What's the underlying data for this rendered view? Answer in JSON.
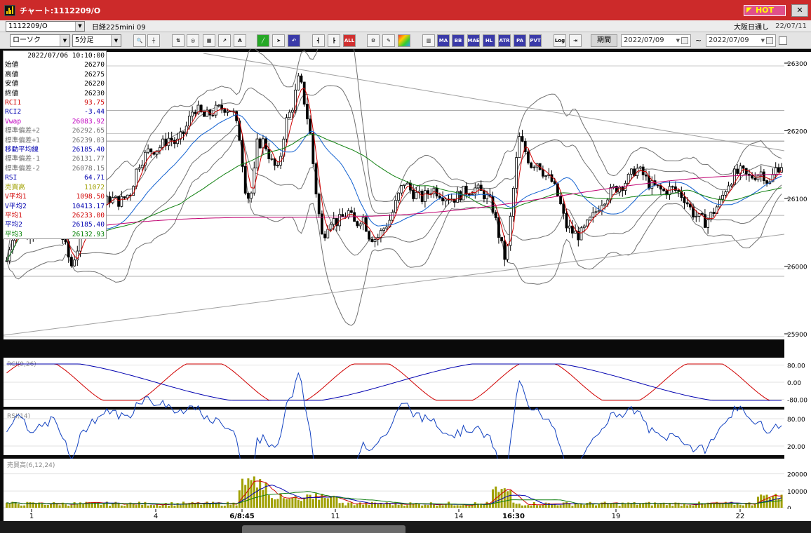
{
  "window": {
    "title": "チャート:1112209/O",
    "hot_label": "HOT",
    "close_glyph": "✕"
  },
  "inforow": {
    "symbol": "1112209/O",
    "instrument_name": "日経225mini 09",
    "market": "大阪日通し",
    "date": "22/07/11"
  },
  "toolbar": {
    "chart_type": "ローソク",
    "interval": "5分足",
    "buttons": [
      "search",
      "crosshair",
      "trend",
      "zoom",
      "grid",
      "line",
      "text",
      "draw",
      "pointer",
      "undo",
      "bar1",
      "bar2",
      "ALL",
      "settings",
      "tools",
      "palette",
      "multi",
      "MA",
      "BB",
      "MAE",
      "HL",
      "ATR",
      "PA",
      "PVT",
      "Log",
      "export"
    ],
    "period_label": "期間",
    "date_from": "2022/07/09",
    "date_to": "2022/07/09",
    "range_sep": "~"
  },
  "infopanel": {
    "timestamp": "2022/07/06  10:10:00",
    "rows": [
      {
        "label": "始値",
        "value": "26270",
        "color": "#000000"
      },
      {
        "label": "高値",
        "value": "26275",
        "color": "#000000"
      },
      {
        "label": "安値",
        "value": "26220",
        "color": "#000000"
      },
      {
        "label": "終値",
        "value": "26230",
        "color": "#000000"
      },
      {
        "label": "RCI1",
        "value": "93.75",
        "color": "#d00000"
      },
      {
        "label": "RCI2",
        "value": "-3.44",
        "color": "#0000b0"
      },
      {
        "label": "Vwap",
        "value": "26083.92",
        "color": "#c000c0"
      },
      {
        "label": "標準偏差+2",
        "value": "26292.65",
        "color": "#707070"
      },
      {
        "label": "標準偏差+1",
        "value": "26239.03",
        "color": "#707070"
      },
      {
        "label": "移動平均線",
        "value": "26185.40",
        "color": "#0000b0"
      },
      {
        "label": "標準偏差-1",
        "value": "26131.77",
        "color": "#707070"
      },
      {
        "label": "標準偏差-2",
        "value": "26078.15",
        "color": "#707070"
      },
      {
        "label": "RSI",
        "value": "64.71",
        "color": "#0000b0"
      },
      {
        "label": "売買高",
        "value": "11072",
        "color": "#a0a000"
      },
      {
        "label": "V平均1",
        "value": "1098.50",
        "color": "#d00000"
      },
      {
        "label": "V平均2",
        "value": "10413.17",
        "color": "#0000b0"
      },
      {
        "label": "平均1",
        "value": "26233.00",
        "color": "#d00000"
      },
      {
        "label": "平均2",
        "value": "26185.40",
        "color": "#0000b0"
      },
      {
        "label": "平均3",
        "value": "26132.93",
        "color": "#008000"
      }
    ]
  },
  "colors": {
    "bg": "#ffffff",
    "candle": "#000000",
    "ma_fast": "#d00000",
    "ma_mid": "#1060d0",
    "ma_slow": "#108010",
    "vwap": "#c00070",
    "bands": "#707070",
    "rsi": "#1040c0",
    "volume": "#a0a000"
  },
  "chart_data": {
    "type": "candlestick",
    "price_axis": {
      "ticks": [
        "26300",
        "26200",
        "26100",
        "26000",
        "25900"
      ]
    },
    "rci_panel": {
      "label": "RCI(9,26)",
      "ticks": [
        "80.00",
        "0.00",
        "-80.00"
      ]
    },
    "rsi_panel": {
      "label": "RSI(14)",
      "ticks": [
        "80.00",
        "20.00"
      ]
    },
    "volume_panel": {
      "label": "売買高(6,12,24)",
      "ticks": [
        "20000",
        "10000",
        "0"
      ]
    },
    "x_labels": [
      "1",
      "4",
      "6/8:45",
      "11",
      "14",
      "16:30",
      "19",
      "22"
    ],
    "close_path": [
      [
        0,
        25960
      ],
      [
        10,
        26020
      ],
      [
        20,
        26060
      ],
      [
        30,
        26075
      ],
      [
        40,
        26050
      ],
      [
        50,
        26045
      ],
      [
        60,
        26055
      ],
      [
        75,
        26075
      ],
      [
        90,
        26035
      ],
      [
        100,
        26000
      ],
      [
        110,
        26030
      ],
      [
        125,
        26065
      ],
      [
        140,
        26085
      ],
      [
        155,
        26100
      ],
      [
        170,
        26095
      ],
      [
        185,
        26110
      ],
      [
        195,
        26150
      ],
      [
        210,
        26170
      ],
      [
        225,
        26175
      ],
      [
        240,
        26190
      ],
      [
        250,
        26180
      ],
      [
        262,
        26200
      ],
      [
        275,
        26235
      ],
      [
        290,
        26220
      ],
      [
        305,
        26230
      ],
      [
        320,
        26235
      ],
      [
        330,
        26230
      ],
      [
        340,
        26190
      ],
      [
        350,
        26100
      ],
      [
        358,
        26110
      ],
      [
        365,
        26180
      ],
      [
        375,
        26185
      ],
      [
        385,
        26155
      ],
      [
        395,
        26140
      ],
      [
        405,
        26210
      ],
      [
        415,
        26235
      ],
      [
        425,
        26280
      ],
      [
        432,
        26245
      ],
      [
        440,
        26200
      ],
      [
        450,
        26100
      ],
      [
        458,
        26040
      ],
      [
        468,
        26070
      ],
      [
        480,
        26065
      ],
      [
        495,
        26080
      ],
      [
        505,
        26060
      ],
      [
        515,
        26075
      ],
      [
        525,
        26045
      ],
      [
        535,
        26040
      ],
      [
        545,
        26055
      ],
      [
        555,
        26070
      ],
      [
        565,
        26100
      ],
      [
        575,
        26125
      ],
      [
        585,
        26110
      ],
      [
        600,
        26100
      ],
      [
        615,
        26115
      ],
      [
        630,
        26105
      ],
      [
        645,
        26100
      ],
      [
        660,
        26110
      ],
      [
        675,
        26115
      ],
      [
        690,
        26105
      ],
      [
        700,
        26090
      ],
      [
        712,
        26035
      ],
      [
        720,
        26005
      ],
      [
        730,
        26110
      ],
      [
        738,
        26190
      ],
      [
        745,
        26175
      ],
      [
        755,
        26150
      ],
      [
        765,
        26155
      ],
      [
        775,
        26135
      ],
      [
        785,
        26125
      ],
      [
        795,
        26100
      ],
      [
        805,
        26060
      ],
      [
        815,
        26050
      ],
      [
        825,
        26045
      ],
      [
        835,
        26060
      ],
      [
        845,
        26075
      ],
      [
        855,
        26095
      ],
      [
        865,
        26105
      ],
      [
        875,
        26115
      ],
      [
        885,
        26120
      ],
      [
        895,
        26130
      ],
      [
        905,
        26145
      ],
      [
        915,
        26135
      ],
      [
        925,
        26120
      ],
      [
        935,
        26115
      ],
      [
        945,
        26110
      ],
      [
        955,
        26115
      ],
      [
        965,
        26110
      ],
      [
        975,
        26100
      ],
      [
        985,
        26080
      ],
      [
        995,
        26070
      ],
      [
        1005,
        26065
      ],
      [
        1015,
        26080
      ],
      [
        1025,
        26095
      ],
      [
        1035,
        26120
      ],
      [
        1045,
        26135
      ],
      [
        1055,
        26140
      ],
      [
        1065,
        26130
      ],
      [
        1075,
        26135
      ],
      [
        1085,
        26140
      ],
      [
        1095,
        26120
      ],
      [
        1105,
        26145
      ],
      [
        1112,
        26150
      ]
    ]
  }
}
